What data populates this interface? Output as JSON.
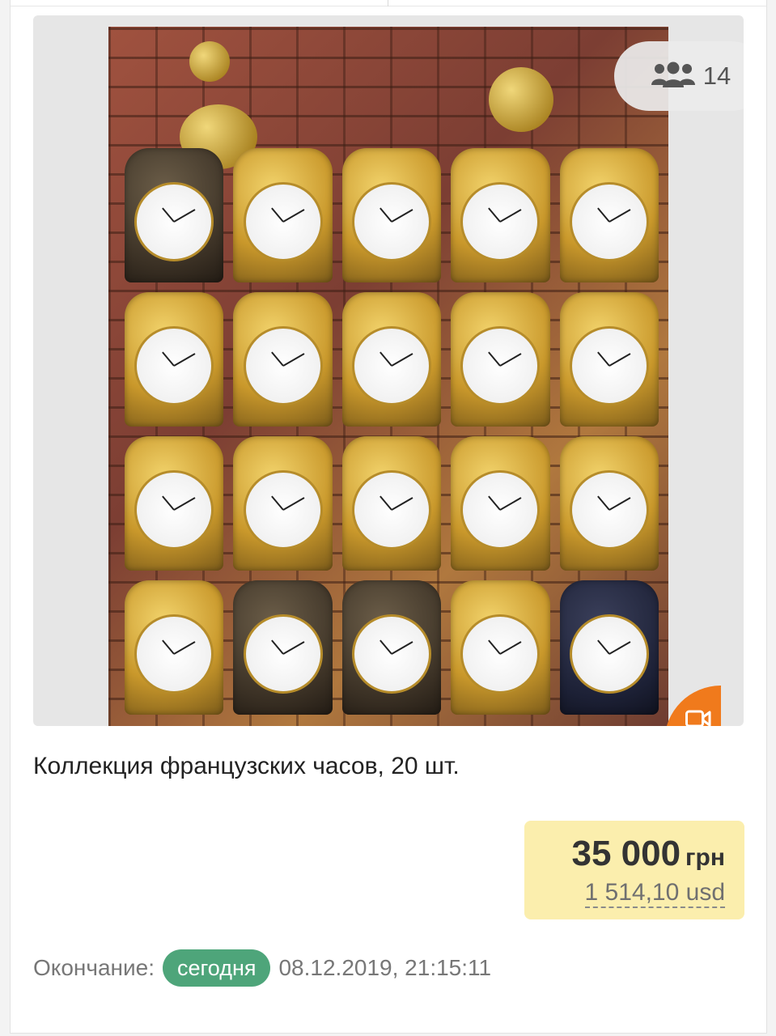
{
  "listing": {
    "viewers_count": "14",
    "title": "Коллекция французских часов, 20 шт.",
    "price": {
      "value": "35 000",
      "currency": "грн",
      "converted": "1 514,10 usd"
    },
    "ends": {
      "label": "Окончание:",
      "badge": "сегодня",
      "datetime": "08.12.2019, 21:15:11"
    }
  },
  "icons": {
    "viewers": "people-group-icon",
    "video": "video-camera-icon"
  },
  "colors": {
    "video_badge": "#f07a1c",
    "today_badge": "#4ea57a",
    "price_background": "#fbeead"
  }
}
